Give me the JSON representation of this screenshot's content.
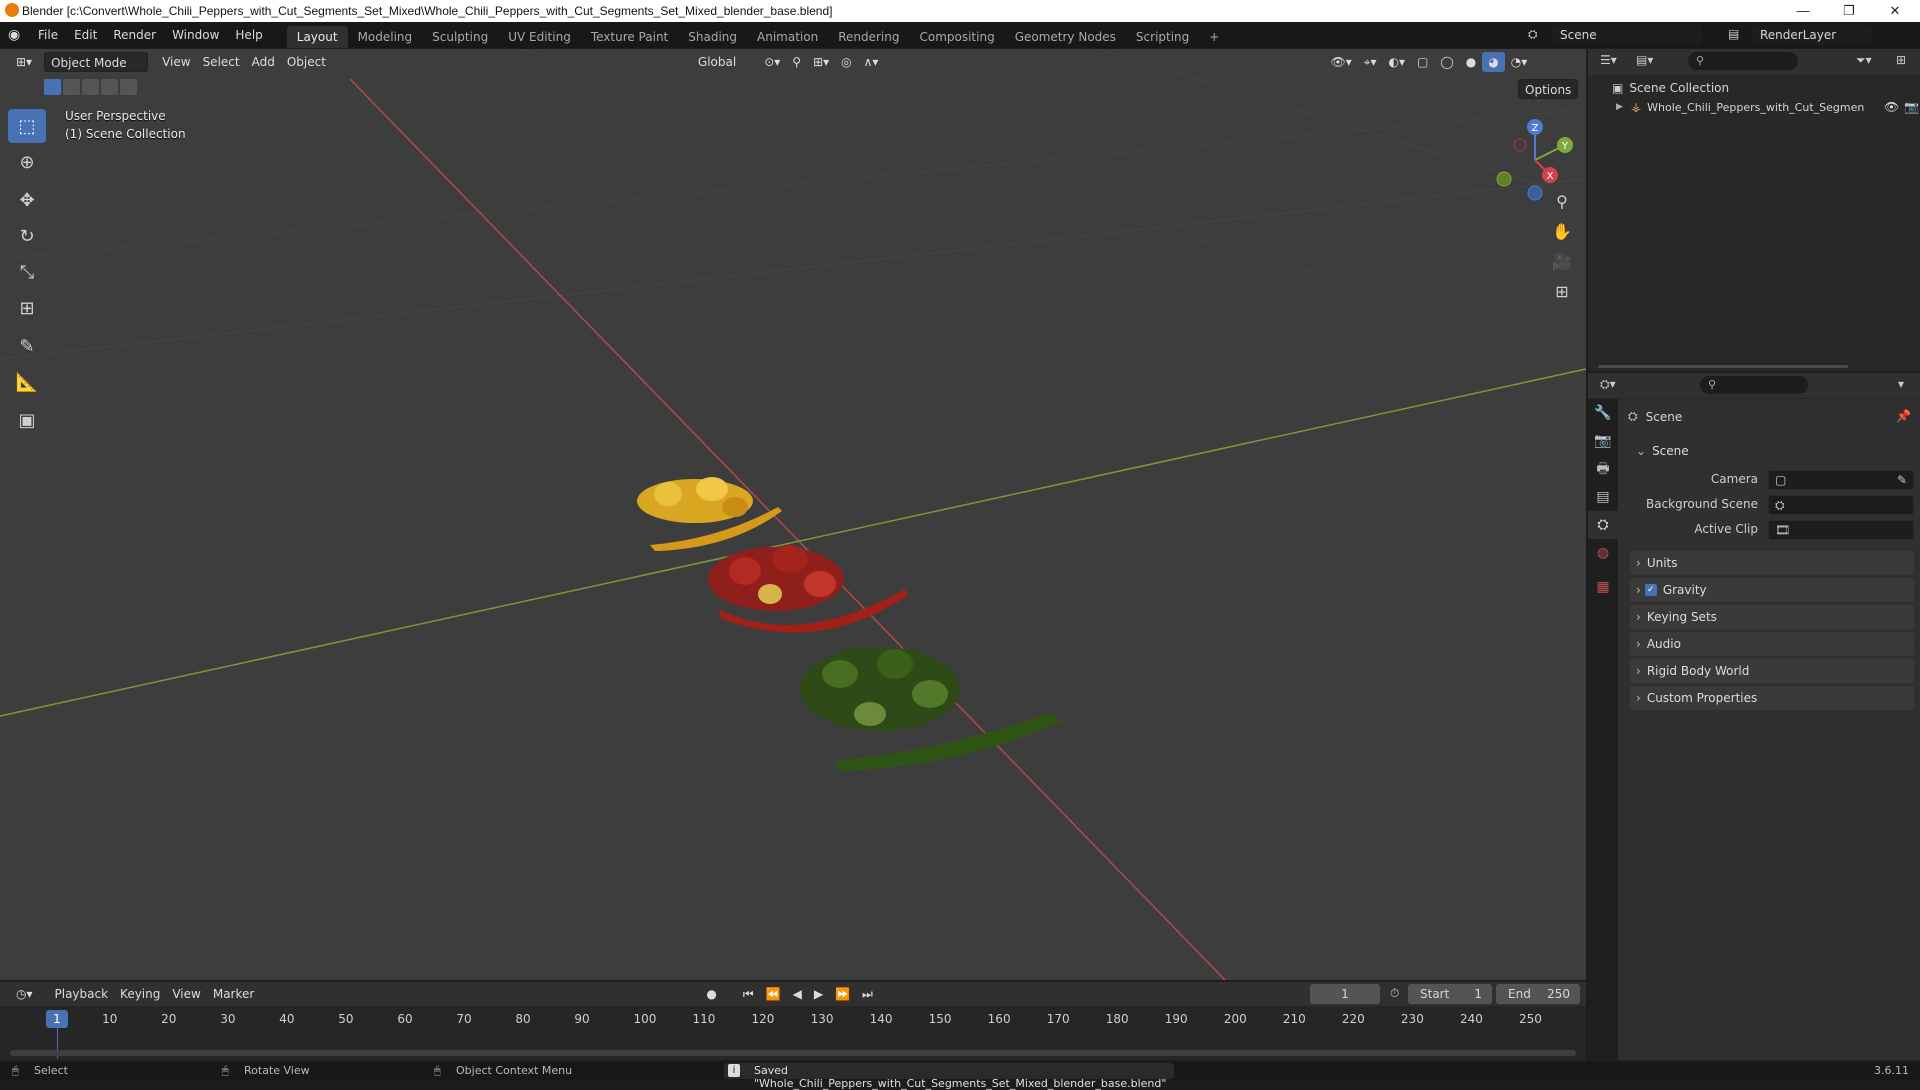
{
  "window": {
    "title": "Blender [c:\\Convert\\Whole_Chili_Peppers_with_Cut_Segments_Set_Mixed\\Whole_Chili_Peppers_with_Cut_Segments_Set_Mixed_blender_base.blend]",
    "minimize": "—",
    "maximize": "❐",
    "close": "✕"
  },
  "menu": {
    "items": [
      "File",
      "Edit",
      "Render",
      "Window",
      "Help"
    ],
    "workspaces": [
      "Layout",
      "Modeling",
      "Sculpting",
      "UV Editing",
      "Texture Paint",
      "Shading",
      "Animation",
      "Rendering",
      "Compositing",
      "Geometry Nodes",
      "Scripting"
    ],
    "active_workspace": "Layout",
    "add_workspace": "+",
    "scene_name": "Scene",
    "view_layer": "RenderLayer"
  },
  "viewport": {
    "mode": "Object Mode",
    "menus": [
      "View",
      "Select",
      "Add",
      "Object"
    ],
    "transform_orientation": "Global",
    "options_label": "Options",
    "perspective_label": "User Perspective",
    "collection_label": "(1) Scene Collection",
    "gizmo": {
      "x": "X",
      "y": "Y",
      "z": "Z"
    }
  },
  "outliner": {
    "root": "Scene Collection",
    "objects": [
      "Whole_Chili_Peppers_with_Cut_Segmen"
    ]
  },
  "properties": {
    "context_title": "Scene",
    "section_scene": "Scene",
    "fields": {
      "camera_label": "Camera",
      "background_scene_label": "Background Scene",
      "active_clip_label": "Active Clip"
    },
    "subpanels": [
      "Units",
      "Gravity",
      "Keying Sets",
      "Audio",
      "Rigid Body World",
      "Custom Properties"
    ],
    "gravity_checked": true
  },
  "timeline": {
    "menus": [
      "Playback",
      "Keying",
      "View",
      "Marker"
    ],
    "current_frame": "1",
    "start_label": "Start",
    "start_value": "1",
    "end_label": "End",
    "end_value": "250",
    "ticks": [
      "1",
      "10",
      "20",
      "30",
      "40",
      "50",
      "60",
      "70",
      "80",
      "90",
      "100",
      "110",
      "120",
      "130",
      "140",
      "150",
      "160",
      "170",
      "180",
      "190",
      "200",
      "210",
      "220",
      "230",
      "240",
      "250"
    ]
  },
  "statusbar": {
    "select": "Select",
    "rotate_view": "Rotate View",
    "context_menu": "Object Context Menu",
    "message": "Saved \"Whole_Chili_Peppers_with_Cut_Segments_Set_Mixed_blender_base.blend\"",
    "version": "3.6.11"
  }
}
